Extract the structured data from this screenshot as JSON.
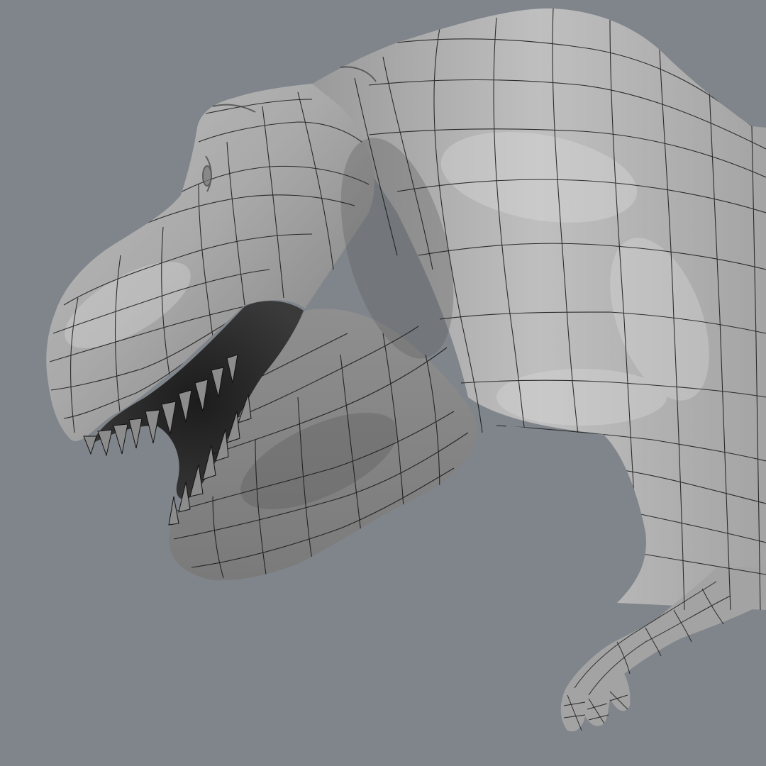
{
  "scene": {
    "subject": "t-rex-wireframe-render",
    "colors": {
      "background": "#7f858b",
      "skin_light": "#c8c8c8",
      "skin_mid": "#9b9b9b",
      "skin_dark": "#5e5e5e",
      "wire": "#141414",
      "mouth": "#262626",
      "teeth": "#8a8a8a"
    }
  }
}
